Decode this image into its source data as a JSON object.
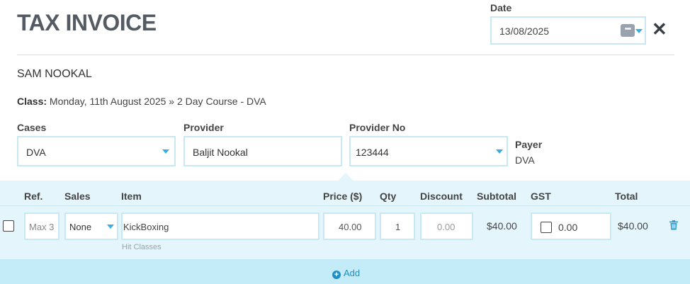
{
  "header": {
    "title": "TAX INVOICE",
    "date_label": "Date",
    "date_value": "13/08/2025",
    "calendar_glyph": "•••",
    "close_glyph": "✕"
  },
  "client": {
    "name": "SAM NOOKAL"
  },
  "class_info": {
    "label": "Class:",
    "value": "Monday, 11th August 2025 » 2 Day Course - DVA"
  },
  "form": {
    "cases_label": "Cases",
    "cases_value": "DVA",
    "provider_label": "Provider",
    "provider_value": "Baljit Nookal",
    "provider_no_label": "Provider No",
    "provider_no_value": "123444",
    "payer_label": "Payer",
    "payer_value": "DVA"
  },
  "table": {
    "headers": {
      "ref": "Ref.",
      "sales": "Sales",
      "item": "Item",
      "price": "Price ($)",
      "qty": "Qty",
      "discount": "Discount",
      "subtotal": "Subtotal",
      "gst": "GST",
      "total": "Total"
    },
    "rows": [
      {
        "selected": false,
        "ref_placeholder": "Max 3",
        "sales": "None",
        "item": "KickBoxing",
        "item_subtext": "Hit Classes",
        "price": "40.00",
        "qty": "1",
        "discount_placeholder": "0.00",
        "subtotal": "$40.00",
        "gst_checked": false,
        "gst": "0.00",
        "total": "$40.00"
      }
    ]
  },
  "add_button": {
    "label": "Add",
    "glyph": "+"
  },
  "colors": {
    "accent": "#3aaee0",
    "link": "#1e8fc0",
    "border": "#c8e9f3",
    "table_bg": "#e4f5fb",
    "add_bar_bg": "#c3ebf8",
    "title": "#555b63"
  },
  "icons": [
    "calendar-icon",
    "close-icon",
    "chevron-down-icon",
    "trash-icon",
    "plus-circle-icon"
  ]
}
